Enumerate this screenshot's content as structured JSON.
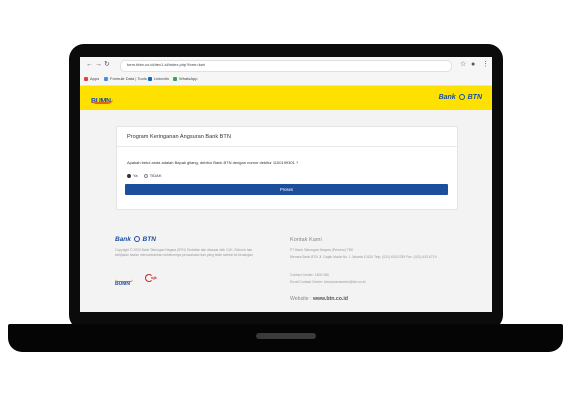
{
  "browser": {
    "url": "form.bbtn.co.id/dev1-id/index.php?form=kwt",
    "bookmarks": [
      {
        "label": "Apps",
        "color": "#e94235"
      },
      {
        "label": "Formulir Data | Tools",
        "color": "#4a90e2"
      },
      {
        "label": "LinkedIn",
        "color": "#0a66c2"
      },
      {
        "label": "WhatsApp",
        "color": "#34a853"
      }
    ]
  },
  "header": {
    "bumn_logo": "BUMN",
    "btn_logo_prefix": "Bank",
    "btn_logo_suffix": "BTN",
    "brand_color": "#ffe100"
  },
  "form": {
    "title": "Program Keringanan Angsuran Bank BTN",
    "question": "Apakah betul anda adalah Bapak gilang, debitur Bank BTN dengan nomor debitur 1100199301 ?",
    "option_yes": "Ya",
    "option_no": "TIDAK",
    "submit_label": "Proses",
    "submit_color": "#1b4f9c"
  },
  "footer": {
    "logo_prefix": "Bank",
    "logo_suffix": "BTN",
    "copyright": "Copyright © 2020 Bank Tabungan Negara (BTN) Terdaftar dan diawasi oleh OJK. Seluruh hak kebijakan badan mencantumkan sebelumnya perusahaan dan yang telah seleksi ke keuangan",
    "bumn_logo": "BUMN",
    "ojk_logo": "ojk",
    "contact_title": "Kontak Kami",
    "company": "PT Bank Tabungan Negara (Persero) TBK",
    "address": "Menara Bank BTN Jl. Gajah Mada No. 1 Jakarta 10130 Telp: (021) 633 6789 Fax: (021) 633 6719",
    "contact_center": "Contact Center: 1500 286",
    "email": "Email Contact Center: btncontactcenter@btn.co.id",
    "website_label": "Website :",
    "website_url": "www.btn.co.id"
  }
}
